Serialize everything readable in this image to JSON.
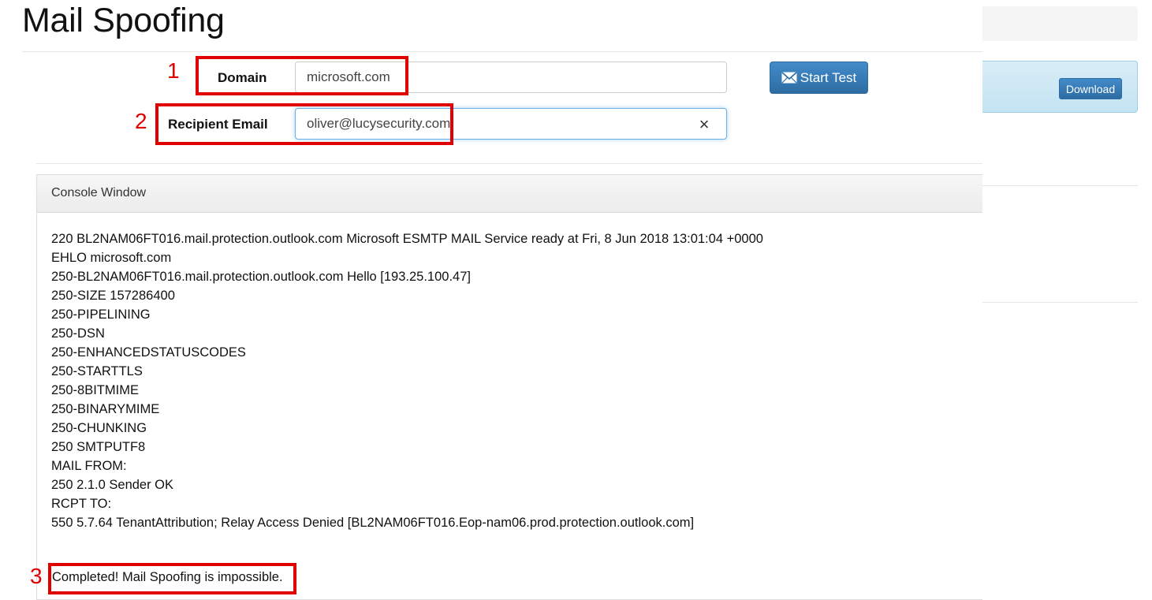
{
  "page": {
    "title": "Mail Spoofing"
  },
  "form": {
    "domain_label": "Domain",
    "domain_value": "microsoft.com",
    "recipient_label": "Recipient Email",
    "recipient_value": "oliver@lucysecurity.com",
    "clear_icon": "×",
    "start_button_label": "Start Test",
    "start_button_icon": "envelope-icon"
  },
  "sidebar": {
    "download_label": "Download"
  },
  "console": {
    "header": "Console Window",
    "lines": [
      "220 BL2NAM06FT016.mail.protection.outlook.com Microsoft ESMTP MAIL Service ready at Fri, 8 Jun 2018 13:01:04 +0000",
      "EHLO microsoft.com",
      "250-BL2NAM06FT016.mail.protection.outlook.com Hello [193.25.100.47]",
      "250-SIZE 157286400",
      "250-PIPELINING",
      "250-DSN",
      "250-ENHANCEDSTATUSCODES",
      "250-STARTTLS",
      "250-8BITMIME",
      "250-BINARYMIME",
      "250-CHUNKING",
      "250 SMTPUTF8",
      "MAIL FROM:",
      "250 2.1.0 Sender OK",
      "RCPT TO:",
      "550 5.7.64 TenantAttribution; Relay Access Denied [BL2NAM06FT016.Eop-nam06.prod.protection.outlook.com]"
    ],
    "result": "Completed! Mail Spoofing is impossible."
  },
  "annotations": [
    "1",
    "2",
    "3"
  ],
  "colors": {
    "annotation": "#e00000",
    "primary_button": "#337ab7",
    "info_panel": "#d9edf7"
  }
}
